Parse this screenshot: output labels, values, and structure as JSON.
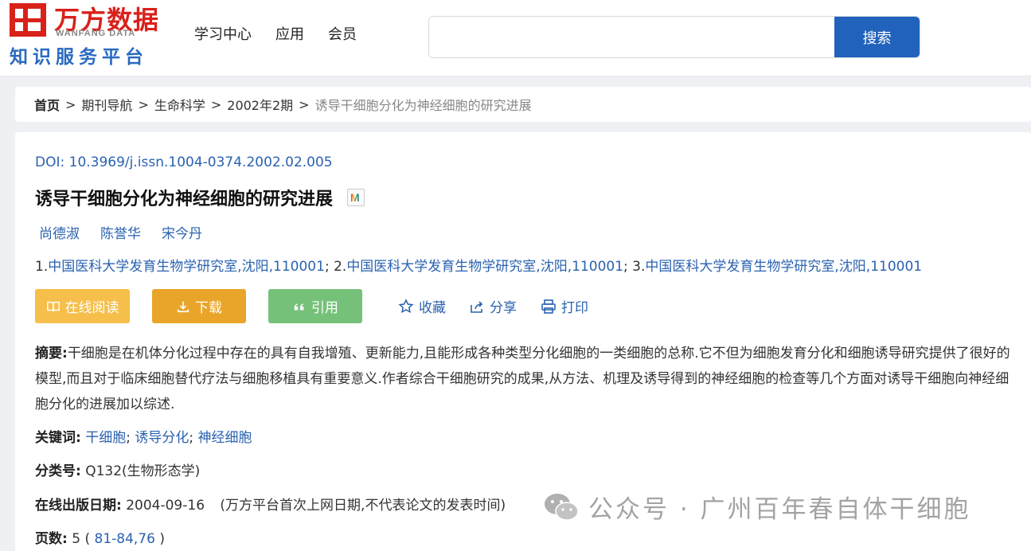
{
  "header": {
    "logo_cn": "万方数据",
    "logo_en": "WANFANG DATA",
    "logo_sub": "知识服务平台",
    "nav": [
      "学习中心",
      "应用",
      "会员"
    ],
    "search_placeholder": "",
    "search_button": "搜索"
  },
  "breadcrumb": {
    "home": "首页",
    "separator": ">",
    "items": [
      "期刊导航",
      "生命科学",
      "2002年2期"
    ],
    "current": "诱导干细胞分化为神经细胞的研究进展"
  },
  "article": {
    "doi_label": "DOI:",
    "doi": "10.3969/j.issn.1004-0374.2002.02.005",
    "title": "诱导干细胞分化为神经细胞的研究进展",
    "badge_icon": "mendeley-m-icon",
    "authors": [
      "尚德淑",
      "陈誉华",
      "宋今丹"
    ],
    "affiliations": [
      {
        "num": "1.",
        "name": "中国医科大学发育生物学研究室,沈阳,110001",
        "sep": ";"
      },
      {
        "num": "2.",
        "name": "中国医科大学发育生物学研究室,沈阳,110001",
        "sep": ";"
      },
      {
        "num": "3.",
        "name": "中国医科大学发育生物学研究室,沈阳,110001",
        "sep": ""
      }
    ],
    "buttons": {
      "read": "在线阅读",
      "download": "下载",
      "cite": "引用"
    },
    "actions": {
      "favorite": "收藏",
      "share": "分享",
      "print": "打印"
    },
    "abstract_label": "摘要:",
    "abstract": "干细胞是在机体分化过程中存在的具有自我增殖、更新能力,且能形成各种类型分化细胞的一类细胞的总称.它不但为细胞发育分化和细胞诱导研究提供了很好的模型,而且对于临床细胞替代疗法与细胞移植具有重要意义.作者综合干细胞研究的成果,从方法、机理及诱导得到的神经细胞的检查等几个方面对诱导干细胞向神经细胞分化的进展加以综述.",
    "keywords_label": "关键词:",
    "keywords": [
      "干细胞",
      "诱导分化",
      "神经细胞"
    ],
    "class_label": "分类号:",
    "class_value": "Q132(生物形态学)",
    "pubdate_label": "在线出版日期:",
    "pubdate": "2004-09-16",
    "pubdate_note": "(万方平台首次上网日期,不代表论文的发表时间)",
    "pages_label": "页数:",
    "pages_count": "5",
    "pages_open": " ( ",
    "pages_range": "81-84,76",
    "pages_close": " )"
  },
  "watermark": "公众号 · 广州百年春自体干细胞",
  "colors": {
    "brand_red": "#d9211b",
    "brand_blue": "#2162bd",
    "link_blue": "#2a62b0",
    "read_btn": "#f6bf4b",
    "download_btn": "#e9a52a",
    "cite_btn": "#76c17a"
  }
}
